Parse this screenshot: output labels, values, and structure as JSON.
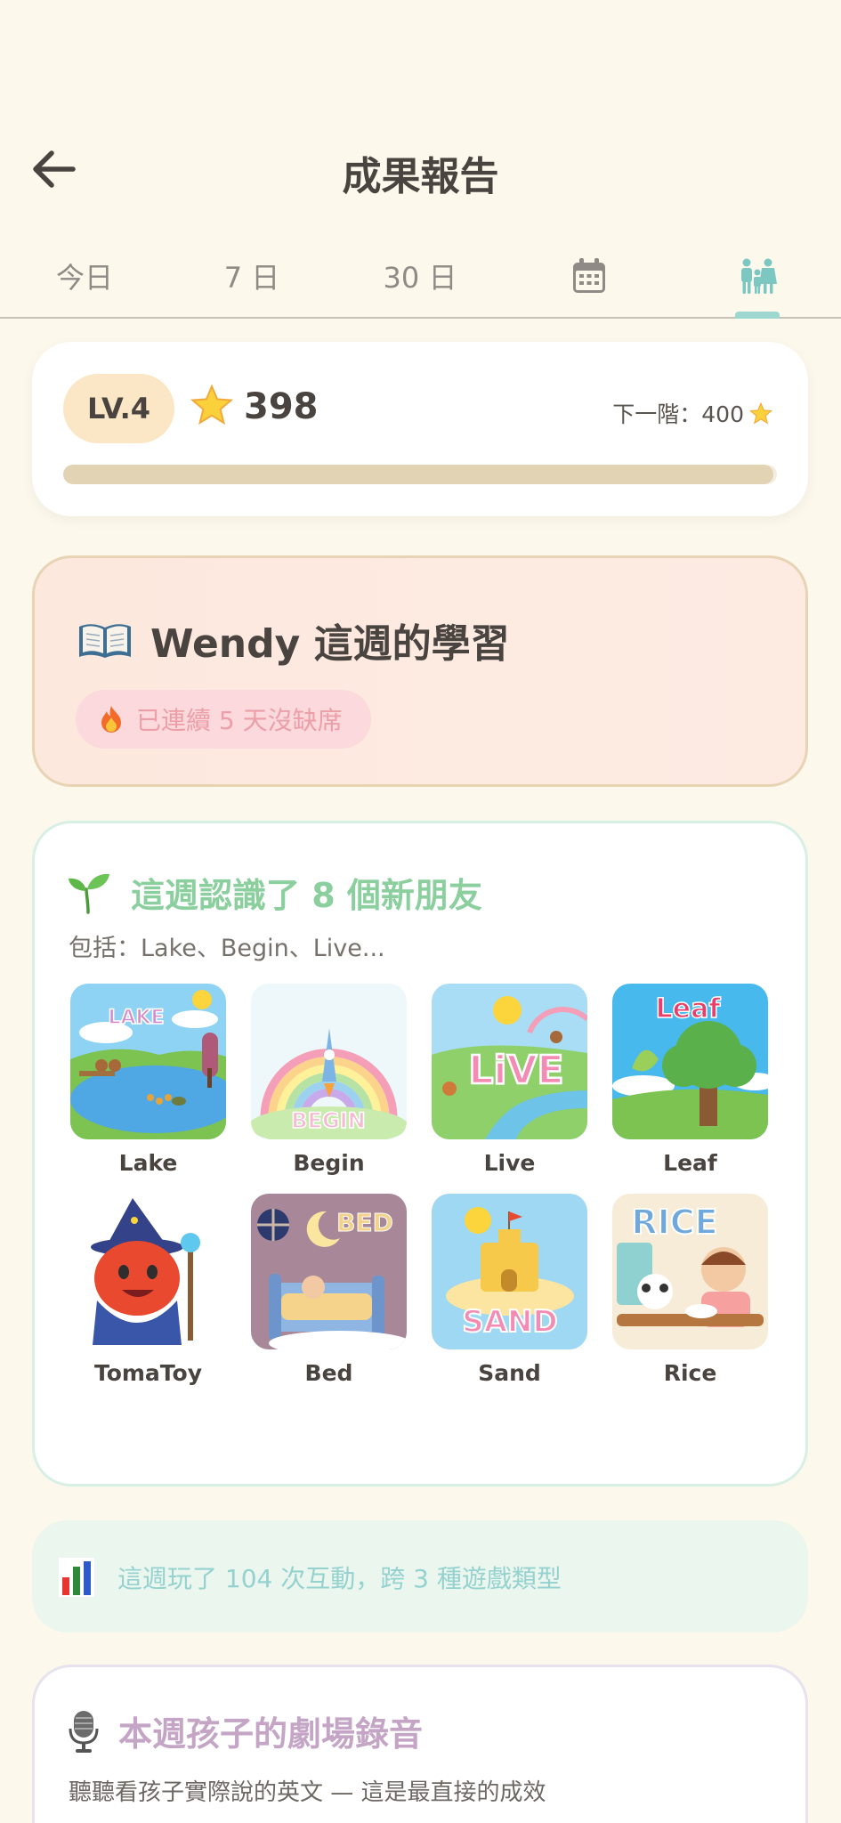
{
  "header": {
    "title": "成果報告"
  },
  "tabs": [
    {
      "label": "今日"
    },
    {
      "label": "7 日"
    },
    {
      "label": "30 日"
    },
    {
      "label": "",
      "icon": "calendar-icon"
    },
    {
      "label": "",
      "icon": "family-icon",
      "active": true
    }
  ],
  "level": {
    "badge": "LV.4",
    "points": "398",
    "next_label": "下一階：400",
    "progress": 0.995
  },
  "weekly": {
    "title": "Wendy 這週的學習",
    "streak": "已連續 5 天沒缺席"
  },
  "words": {
    "title": "這週認識了 8 個新朋友",
    "subtitle": "包括：Lake、Begin、Live...",
    "items": [
      {
        "label": "Lake",
        "art_text": "LAKE"
      },
      {
        "label": "Begin",
        "art_text": "BEGIN"
      },
      {
        "label": "Live",
        "art_text": "LiVE"
      },
      {
        "label": "Leaf",
        "art_text": "Leaf"
      },
      {
        "label": "TomaToy"
      },
      {
        "label": "Bed",
        "art_text": "BED"
      },
      {
        "label": "Sand",
        "art_text": "SAND"
      },
      {
        "label": "Rice",
        "art_text": "RICE"
      }
    ]
  },
  "interactions": {
    "text": "這週玩了 104 次互動，跨 3 種遊戲類型"
  },
  "recordings": {
    "title": "本週孩子的劇場錄音",
    "subtitle": "聽聽看孩子實際說的英文 — 這是最直接的成效"
  },
  "colors": {
    "background": "#fdf8ec",
    "accent_teal": "#9ed6d0",
    "green": "#8ccf9f",
    "pink": "#ec9fa8",
    "purple": "#c4a5c6"
  }
}
